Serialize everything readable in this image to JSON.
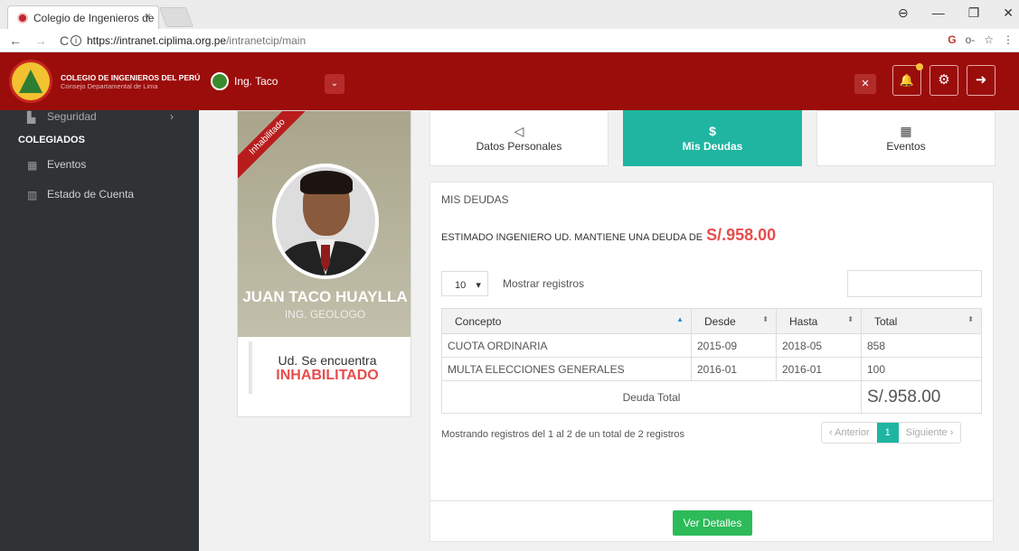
{
  "browser": {
    "tab_title": "Colegio de Ingenieros de",
    "tab_close": "×",
    "url_host": "https://intranet.ciplima.org.pe",
    "url_path": "/intranetcip/main",
    "info_glyph": "i",
    "back_glyph": "←",
    "forward_glyph": "→",
    "reload_glyph": "C",
    "ext_icon": "G",
    "key_icon": "o-",
    "star_icon": "☆",
    "menu_icon": "⋮",
    "account_icon": "⊖",
    "min_glyph": "—",
    "max_glyph": "❐",
    "close_glyph": "✕"
  },
  "header": {
    "org_line1": "COLEGIO DE INGENIEROS DEL PERÚ",
    "org_line2": "Consejo Departamental de Lima",
    "user_name": "Ing. Taco",
    "dropdown_glyph": "⌄",
    "fullscreen_glyph": "✕",
    "bell_glyph": "🔔",
    "gear_glyph": "⚙",
    "logout_glyph": "➜"
  },
  "sidebar": {
    "security_label": "Seguridad",
    "security_chevron": "›",
    "section_heading": "COLEGIADOS",
    "items": [
      {
        "label": "Eventos",
        "icon": "calendar-icon"
      },
      {
        "label": "Estado de Cuenta",
        "icon": "bar-chart-icon"
      }
    ]
  },
  "profile": {
    "ribbon": "Inhabilitado",
    "name": "JUAN TACO HUAYLLA",
    "profession": "ING. GEOLOGO",
    "status_line1": "Ud. Se encuentra",
    "status_line2": "INHABILITADO"
  },
  "tabs": [
    {
      "label": "Datos Personales",
      "icon": "megaphone-icon",
      "glyph": "📢"
    },
    {
      "label": "Mis Deudas",
      "icon": "dollar-icon",
      "glyph": "$"
    },
    {
      "label": "Eventos",
      "icon": "calendar-icon",
      "glyph": "▦"
    }
  ],
  "debts": {
    "title": "MIS DEUDAS",
    "message": "ESTIMADO INGENIERO UD. MANTIENE UNA DEUDA DE",
    "amount": "S/.958.00",
    "page_length": "10",
    "page_length_arrow": "▾",
    "page_length_label": "Mostrar registros",
    "columns": [
      "Concepto",
      "Desde",
      "Hasta",
      "Total"
    ],
    "rows": [
      {
        "concepto": "CUOTA ORDINARIA",
        "desde": "2015-09",
        "hasta": "2018-05",
        "total": "858"
      },
      {
        "concepto": "MULTA ELECCIONES GENERALES",
        "desde": "2016-01",
        "hasta": "2016-01",
        "total": "100"
      }
    ],
    "total_label": "Deuda Total",
    "total_value": "S/.958.00",
    "info": "Mostrando registros del 1 al 2 de un total de 2 registros",
    "prev": "‹ Anterior",
    "page": "1",
    "next": "Siguiente ›",
    "details_button": "Ver Detalles"
  },
  "colors": {
    "header_bg": "#9b0d0b",
    "sidebar_bg": "#2f3336",
    "accent_teal": "#1fb5a1",
    "debt_red": "#e74c4c",
    "total_blue": "#3b7cbd",
    "button_green": "#2dbb59"
  }
}
